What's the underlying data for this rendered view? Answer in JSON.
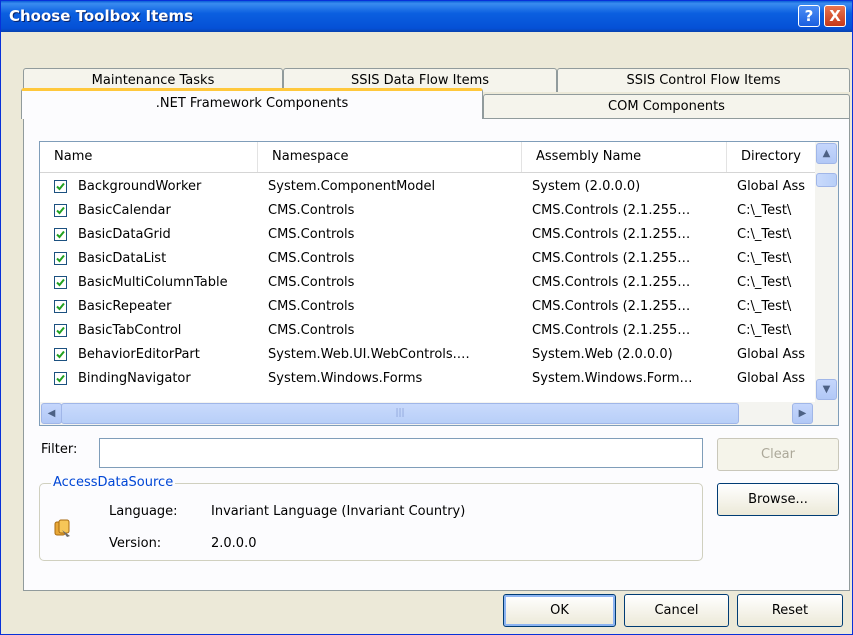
{
  "window": {
    "title": "Choose Toolbox Items",
    "help_glyph": "?",
    "close_glyph": "X"
  },
  "tabs": {
    "back_row": [
      "Maintenance Tasks",
      "SSIS Data Flow Items",
      "SSIS Control Flow Items"
    ],
    "front_row": [
      ".NET Framework Components",
      "COM Components"
    ],
    "active": ".NET Framework Components"
  },
  "list": {
    "columns": [
      "Name",
      "Namespace",
      "Assembly Name",
      "Directory"
    ],
    "rows": [
      {
        "checked": true,
        "name": "BackgroundWorker",
        "namespace": "System.ComponentModel",
        "assembly": "System (2.0.0.0)",
        "directory": "Global Ass"
      },
      {
        "checked": true,
        "name": "BasicCalendar",
        "namespace": "CMS.Controls",
        "assembly": "CMS.Controls (2.1.255…",
        "directory": "C:\\_Test\\"
      },
      {
        "checked": true,
        "name": "BasicDataGrid",
        "namespace": "CMS.Controls",
        "assembly": "CMS.Controls (2.1.255…",
        "directory": "C:\\_Test\\"
      },
      {
        "checked": true,
        "name": "BasicDataList",
        "namespace": "CMS.Controls",
        "assembly": "CMS.Controls (2.1.255…",
        "directory": "C:\\_Test\\"
      },
      {
        "checked": true,
        "name": "BasicMultiColumnTable",
        "namespace": "CMS.Controls",
        "assembly": "CMS.Controls (2.1.255…",
        "directory": "C:\\_Test\\"
      },
      {
        "checked": true,
        "name": "BasicRepeater",
        "namespace": "CMS.Controls",
        "assembly": "CMS.Controls (2.1.255…",
        "directory": "C:\\_Test\\"
      },
      {
        "checked": true,
        "name": "BasicTabControl",
        "namespace": "CMS.Controls",
        "assembly": "CMS.Controls (2.1.255…",
        "directory": "C:\\_Test\\"
      },
      {
        "checked": true,
        "name": "BehaviorEditorPart",
        "namespace": "System.Web.UI.WebControls.…",
        "assembly": "System.Web (2.0.0.0)",
        "directory": "Global Ass"
      },
      {
        "checked": true,
        "name": "BindingNavigator",
        "namespace": "System.Windows.Forms",
        "assembly": "System.Windows.Form…",
        "directory": "Global Ass"
      }
    ]
  },
  "filter": {
    "label": "Filter:",
    "value": "",
    "clear_label": "Clear"
  },
  "details": {
    "group_title": "AccessDataSource",
    "language_label": "Language:",
    "language_value": "Invariant Language (Invariant Country)",
    "version_label": "Version:",
    "version_value": "2.0.0.0",
    "icon": "assembly-icon"
  },
  "buttons": {
    "browse": "Browse...",
    "ok": "OK",
    "cancel": "Cancel",
    "reset": "Reset"
  },
  "colors": {
    "titlebar": "#0550d6",
    "active_tab_accent": "#ffc83c",
    "group_title": "#0046d5",
    "dialog_bg": "#ece9d8"
  }
}
